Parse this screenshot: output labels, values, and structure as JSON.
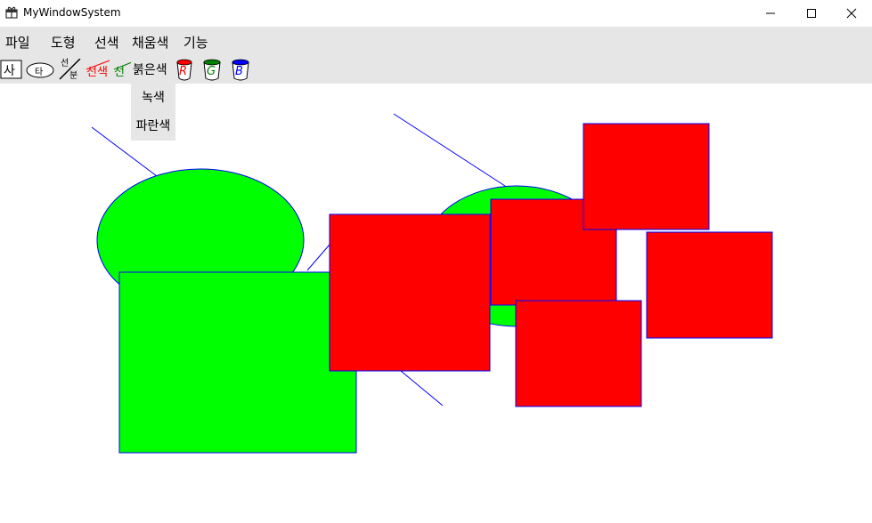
{
  "window": {
    "title": "MyWindowSystem"
  },
  "menu": {
    "items": [
      "파일",
      "도형",
      "선색",
      "채움색",
      "기능"
    ]
  },
  "toolbar": {
    "select_label": "사",
    "ellipse_label": "타",
    "line_label_top": "선",
    "line_label_bottom": "분",
    "linecolor_label": "선색",
    "linecolor2_label": "선",
    "red_label": "붉은색",
    "r_label": "R",
    "g_label": "G",
    "b_label": "B"
  },
  "dropdown": {
    "items": [
      "녹색",
      "파란색"
    ]
  },
  "colors": {
    "green_fill": "#00ff00",
    "red_fill": "#ff0000",
    "stroke": "#0000ff"
  }
}
